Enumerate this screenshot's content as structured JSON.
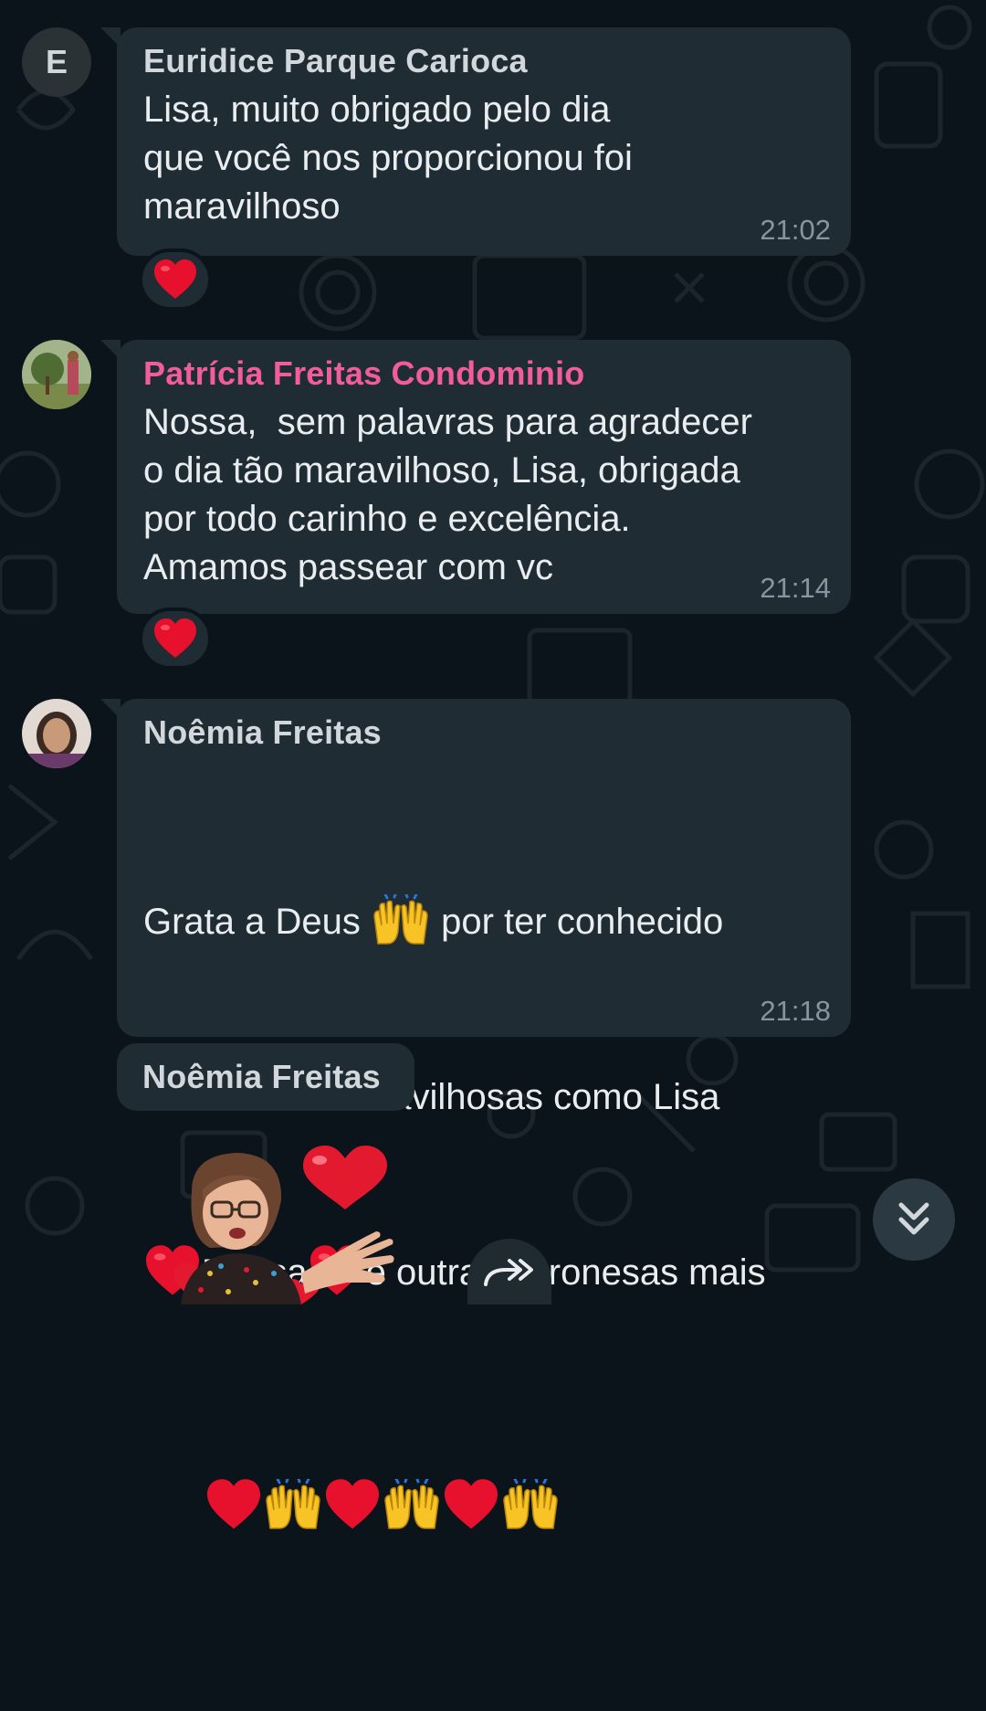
{
  "messages": [
    {
      "sender": "Euridice Parque Carioca",
      "sender_color": "#d1d7db",
      "avatar_letter": "E",
      "text": "Lisa, muito obrigado pelo dia\nque você nos proporcionou foi\nmaravilhoso",
      "time": "21:02",
      "reaction": "heart-emoji"
    },
    {
      "sender": "Patrícia Freitas Condominio",
      "sender_color": "#f15c9b",
      "text": "Nossa,  sem palavras para agradecer\no dia tão maravilhoso, Lisa, obrigada\npor todo carinho e excelência.\nAmamos passear com vc",
      "time": "21:14",
      "reaction": "heart-emoji"
    },
    {
      "sender": "Noêmia Freitas",
      "sender_color": "#d1d7db",
      "text_parts": [
        "Grata a Deus ",
        " por ter conhecido",
        "PESSOAS maravilhosas como Lisa",
        "Deusa",
        "e outras baronesas mais"
      ],
      "time": "21:18"
    },
    {
      "sender": "Noêmia Freitas",
      "sender_color": "#d1d7db",
      "content": "sticker-woman-with-hearts"
    }
  ]
}
